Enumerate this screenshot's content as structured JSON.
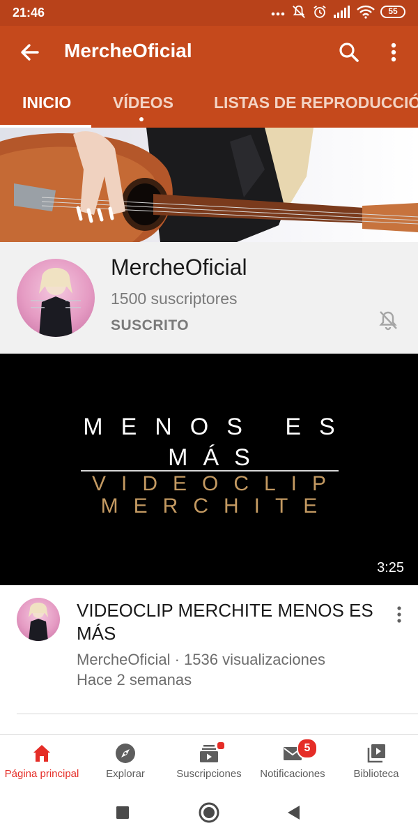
{
  "status_bar": {
    "time": "21:46",
    "battery": "55"
  },
  "app_bar": {
    "title": "MercheOficial"
  },
  "tabs": [
    {
      "label": "INICIO",
      "active": true
    },
    {
      "label": "VÍDEOS",
      "active": false
    },
    {
      "label": "LISTAS DE REPRODUCCIÓN",
      "active": false
    }
  ],
  "channel": {
    "name": "MercheOficial",
    "subscribers": "1500 suscriptores",
    "subscribe_state": "SUSCRITO"
  },
  "video": {
    "thumbnail_lines": [
      "MENOS ES",
      "MÁS",
      "VIDEOCLIP",
      "MERCHITE"
    ],
    "duration": "3:25",
    "title": "VIDEOCLIP MERCHITE MENOS ES MÁS",
    "meta_line1": "MercheOficial · 1536 visualizaciones",
    "meta_line2": "Hace 2 semanas"
  },
  "bottom_nav": [
    {
      "label": "Página principal",
      "icon": "home-icon",
      "active": true
    },
    {
      "label": "Explorar",
      "icon": "explore-icon",
      "active": false
    },
    {
      "label": "Suscripciones",
      "icon": "subscriptions-icon",
      "active": false
    },
    {
      "label": "Notificaciones",
      "icon": "notifications-icon",
      "active": false,
      "badge": "5"
    },
    {
      "label": "Biblioteca",
      "icon": "library-icon",
      "active": false
    }
  ],
  "colors": {
    "brand": "#c5491c",
    "status_bar": "#b8421a",
    "active_red": "#e52d27"
  }
}
